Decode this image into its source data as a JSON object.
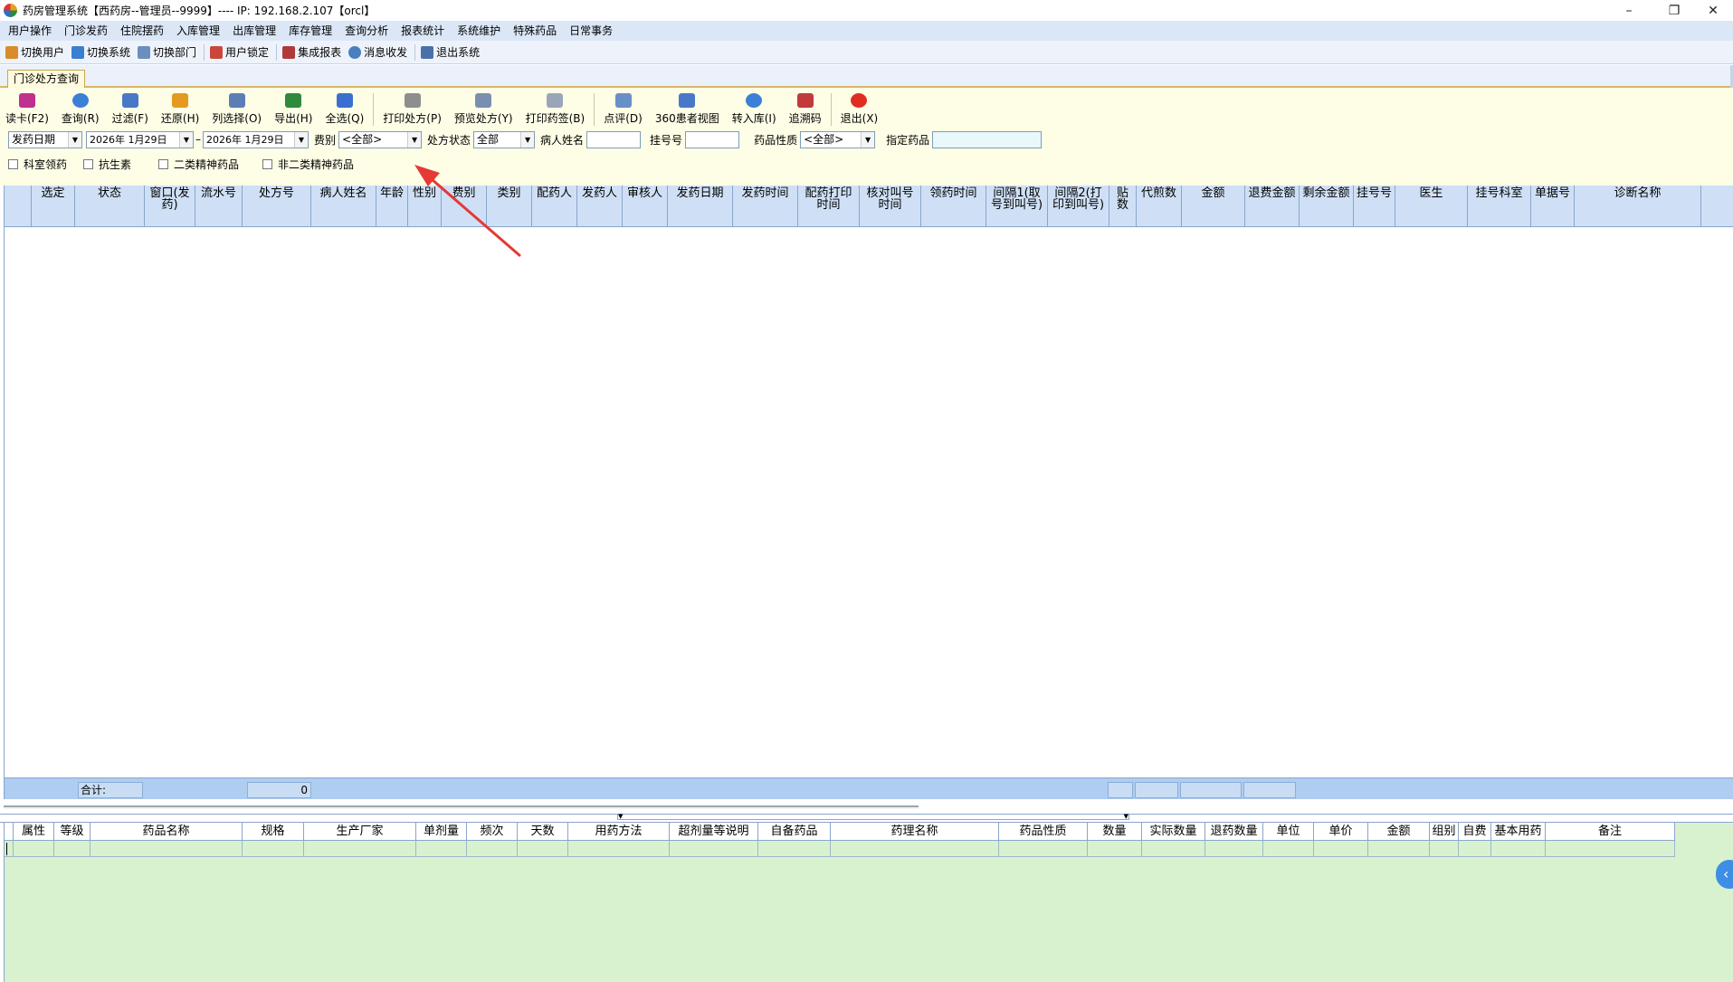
{
  "window": {
    "title": "药房管理系统【西药房--管理员--9999】---- IP: 192.168.2.107【orcl】",
    "minimize": "–",
    "restore": "❐",
    "close": "✕"
  },
  "menu": [
    "用户操作",
    "门诊发药",
    "住院摆药",
    "入库管理",
    "出库管理",
    "库存管理",
    "查询分析",
    "报表统计",
    "系统维护",
    "特殊药品",
    "日常事务"
  ],
  "quickbar": [
    {
      "label": "切换用户",
      "icon": "switch-user-icon",
      "color": "#d98c2b"
    },
    {
      "label": "切换系统",
      "icon": "switch-system-icon",
      "color": "#3a7fd0"
    },
    {
      "label": "切换部门",
      "icon": "switch-dept-icon",
      "color": "#6a8fbf"
    },
    {
      "label": "用户锁定",
      "icon": "user-lock-icon",
      "color": "#c9473a"
    },
    {
      "label": "集成报表",
      "icon": "report-icon",
      "color": "#b03a3a"
    },
    {
      "label": "消息收发",
      "icon": "message-icon",
      "color": "#4a7fc0"
    },
    {
      "label": "退出系统",
      "icon": "exit-icon",
      "color": "#4a70a8"
    }
  ],
  "tab": {
    "label": "门诊处方查询"
  },
  "toolbar": [
    {
      "label": "读卡(F2)",
      "icon": "card-reader-icon",
      "color": "#c0308c"
    },
    {
      "label": "查询(R)",
      "icon": "refresh-icon",
      "color": "#3c7fd6"
    },
    {
      "label": "过滤(F)",
      "icon": "filter-icon",
      "color": "#4a78c8"
    },
    {
      "label": "还原(H)",
      "icon": "undo-icon",
      "color": "#e59a1f"
    },
    {
      "label": "列选择(O)",
      "icon": "columns-icon",
      "color": "#5b7fb5"
    },
    {
      "label": "导出(H)",
      "icon": "excel-icon",
      "color": "#2f8a3c"
    },
    {
      "label": "全选(Q)",
      "icon": "plus-icon",
      "color": "#3a6fd0"
    },
    {
      "label": "打印处方(P)",
      "icon": "printer-icon",
      "color": "#8e8e8e"
    },
    {
      "label": "预览处方(Y)",
      "icon": "preview-icon",
      "color": "#7a8fb0"
    },
    {
      "label": "打印药签(B)",
      "icon": "label-print-icon",
      "color": "#9aa6b8"
    },
    {
      "label": "点评(D)",
      "icon": "review-icon",
      "color": "#6a8fc8"
    },
    {
      "label": "360患者视图",
      "icon": "patient-view-icon",
      "color": "#4a78c8"
    },
    {
      "label": "转入库(I)",
      "icon": "transfer-icon",
      "color": "#3c7fd6"
    },
    {
      "label": "追溯码",
      "icon": "barcode-icon",
      "color": "#c23a3a"
    },
    {
      "label": "退出(X)",
      "icon": "power-icon",
      "color": "#e02d1f"
    }
  ],
  "filters": {
    "date_type": "发药日期",
    "date_from": "2026年 1月29日",
    "date_sep": "–",
    "date_to": "2026年 1月29日",
    "fee_type_label": "费别",
    "fee_type_value": "<全部>",
    "rx_status_label": "处方状态",
    "rx_status_value": "全部",
    "patient_name_label": "病人姓名",
    "reg_no_label": "挂号号",
    "drug_nature_label": "药品性质",
    "drug_nature_value": "<全部>",
    "specified_drug_label": "指定药品"
  },
  "checkboxes": [
    "科室领药",
    "抗生素",
    "二类精神药品",
    "非二类精神药品"
  ],
  "top_grid": {
    "columns": [
      "选定",
      "状态",
      "窗口(发药)",
      "流水号",
      "处方号",
      "病人姓名",
      "年龄",
      "性别",
      "费别",
      "类别",
      "配药人",
      "发药人",
      "审核人",
      "发药日期",
      "发药时间",
      "配药打印时间",
      "核对叫号时间",
      "领药时间",
      "间隔1(取号到叫号)",
      "间隔2(打印到叫号)",
      "贴数",
      "代煎数",
      "金额",
      "退费金额",
      "剩余金额",
      "挂号号",
      "医生",
      "挂号科室",
      "单据号",
      "诊断名称"
    ],
    "footer_label": "合计:",
    "footer_count": "0"
  },
  "bottom_grid": {
    "columns": [
      "属性",
      "等级",
      "药品名称",
      "规格",
      "生产厂家",
      "单剂量",
      "频次",
      "天数",
      "用药方法",
      "超剂量等说明",
      "自备药品",
      "药理名称",
      "药品性质",
      "数量",
      "实际数量",
      "退药数量",
      "单位",
      "单价",
      "金额",
      "组别",
      "自费",
      "基本用药",
      "备注"
    ]
  },
  "side_tab": "‹",
  "colors": {
    "menubar": "#dbe7f7",
    "panel": "#fefde6",
    "grid_header": "#cfe0f6",
    "lower_grid": "#d8f2cf",
    "annotation": "#e53935"
  }
}
